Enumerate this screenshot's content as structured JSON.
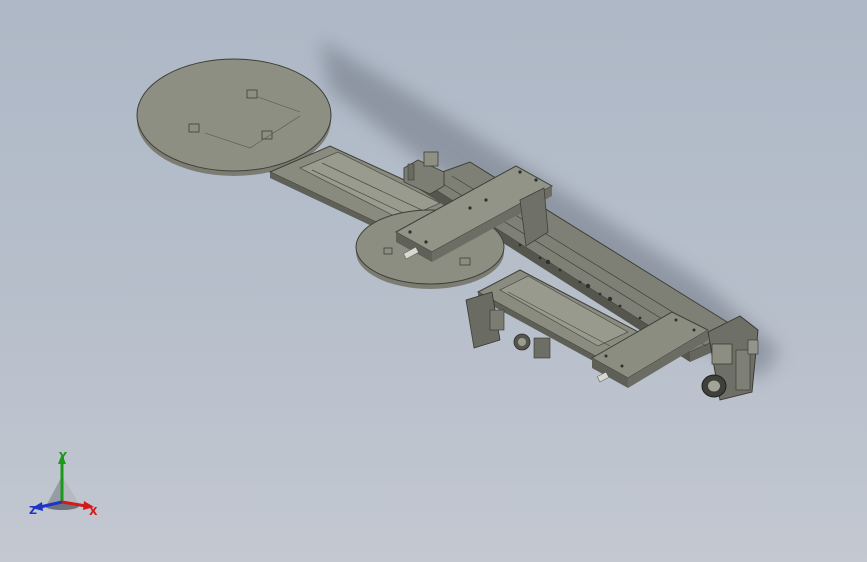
{
  "viewport": {
    "background_top": "#aeb8c6",
    "background_bottom": "#c3c8d1",
    "model_color": "#8a8b7e"
  },
  "triad": {
    "x_label": "X",
    "y_label": "Y",
    "z_label": "Z",
    "x_color": "#d21a1a",
    "y_color": "#1a9a1a",
    "z_color": "#1f35c9"
  }
}
